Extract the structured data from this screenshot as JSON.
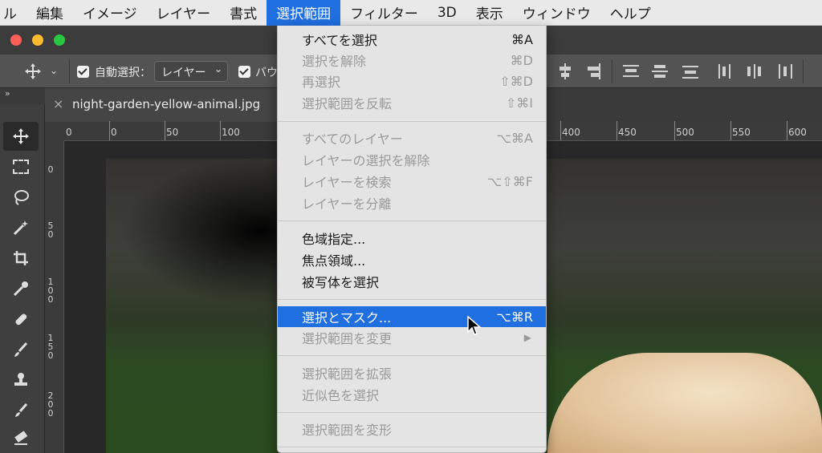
{
  "menubar": {
    "items": [
      "ル",
      "編集",
      "イメージ",
      "レイヤー",
      "書式",
      "選択範囲",
      "フィルター",
      "3D",
      "表示",
      "ウィンドウ",
      "ヘルプ"
    ],
    "active": "選択範囲"
  },
  "options": {
    "auto_select_label": "自動選択：",
    "auto_select_value": "レイヤー",
    "bounding_label": "バウ"
  },
  "panel_toggle": "»",
  "document": {
    "tab_close": "×",
    "tab_title": "night-garden-yellow-animal.jpg"
  },
  "ruler": {
    "top_labels": [
      "0",
      "0",
      "50",
      "100",
      "400",
      "450",
      "500",
      "550",
      "600"
    ],
    "left_labels": [
      "0",
      "5\n0",
      "1\n0\n0",
      "1\n5\n0",
      "2\n0\n0"
    ]
  },
  "select_menu": {
    "items": [
      {
        "label": "すべてを選択",
        "shortcut": "⌘A",
        "disabled": false
      },
      {
        "label": "選択を解除",
        "shortcut": "⌘D",
        "disabled": true
      },
      {
        "label": "再選択",
        "shortcut": "⇧⌘D",
        "disabled": true
      },
      {
        "label": "選択範囲を反転",
        "shortcut": "⇧⌘I",
        "disabled": true
      },
      {
        "label": "すべてのレイヤー",
        "shortcut": "⌥⌘A",
        "disabled": true
      },
      {
        "label": "レイヤーの選択を解除",
        "shortcut": "",
        "disabled": true
      },
      {
        "label": "レイヤーを検索",
        "shortcut": "⌥⇧⌘F",
        "disabled": true
      },
      {
        "label": "レイヤーを分離",
        "shortcut": "",
        "disabled": true
      },
      {
        "label": "色域指定...",
        "shortcut": "",
        "disabled": false
      },
      {
        "label": "焦点領域...",
        "shortcut": "",
        "disabled": false
      },
      {
        "label": "被写体を選択",
        "shortcut": "",
        "disabled": false
      },
      {
        "label": "選択とマスク...",
        "shortcut": "⌥⌘R",
        "disabled": false,
        "highlighted": true
      },
      {
        "label": "選択範囲を変更",
        "shortcut": "▶",
        "disabled": true
      },
      {
        "label": "選択範囲を拡張",
        "shortcut": "",
        "disabled": true
      },
      {
        "label": "近似色を選択",
        "shortcut": "",
        "disabled": true
      },
      {
        "label": "選択範囲を変形",
        "shortcut": "",
        "disabled": true
      }
    ]
  },
  "tools": [
    "move-tool",
    "marquee-tool",
    "lasso-tool",
    "magic-wand-tool",
    "crop-tool",
    "eyedropper-tool",
    "healing-brush-tool",
    "brush-tool",
    "clone-stamp-tool",
    "history-brush-tool",
    "eraser-tool"
  ],
  "colors": {
    "accent": "#1f6fe0",
    "menu_bg": "#e4e4e4"
  }
}
